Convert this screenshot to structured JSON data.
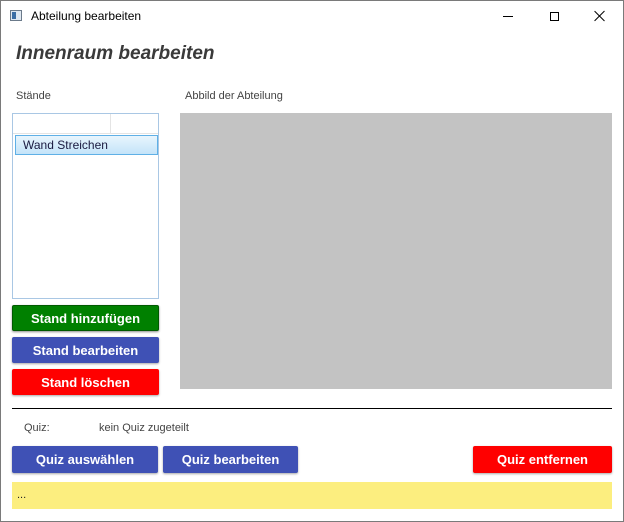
{
  "window": {
    "title": "Abteilung bearbeiten"
  },
  "page": {
    "title": "Innenraum bearbeiten"
  },
  "stands": {
    "label": "Stände",
    "items": [
      {
        "label": "Wand Streichen",
        "selected": true
      }
    ],
    "buttons": {
      "add": "Stand hinzufügen",
      "edit": "Stand bearbeiten",
      "delete": "Stand löschen"
    }
  },
  "department_image": {
    "label": "Abbild der Abteilung"
  },
  "quiz": {
    "label": "Quiz:",
    "value": "kein Quiz zugeteilt",
    "buttons": {
      "select": "Quiz auswählen",
      "edit": "Quiz bearbeiten",
      "remove": "Quiz entfernen"
    }
  },
  "status": {
    "text": "..."
  },
  "colors": {
    "add_button": "#008000",
    "primary_button": "#3f51b5",
    "danger_button": "#ff0000",
    "image_placeholder": "#c3c3c3",
    "status_bar": "#fcee7f"
  }
}
